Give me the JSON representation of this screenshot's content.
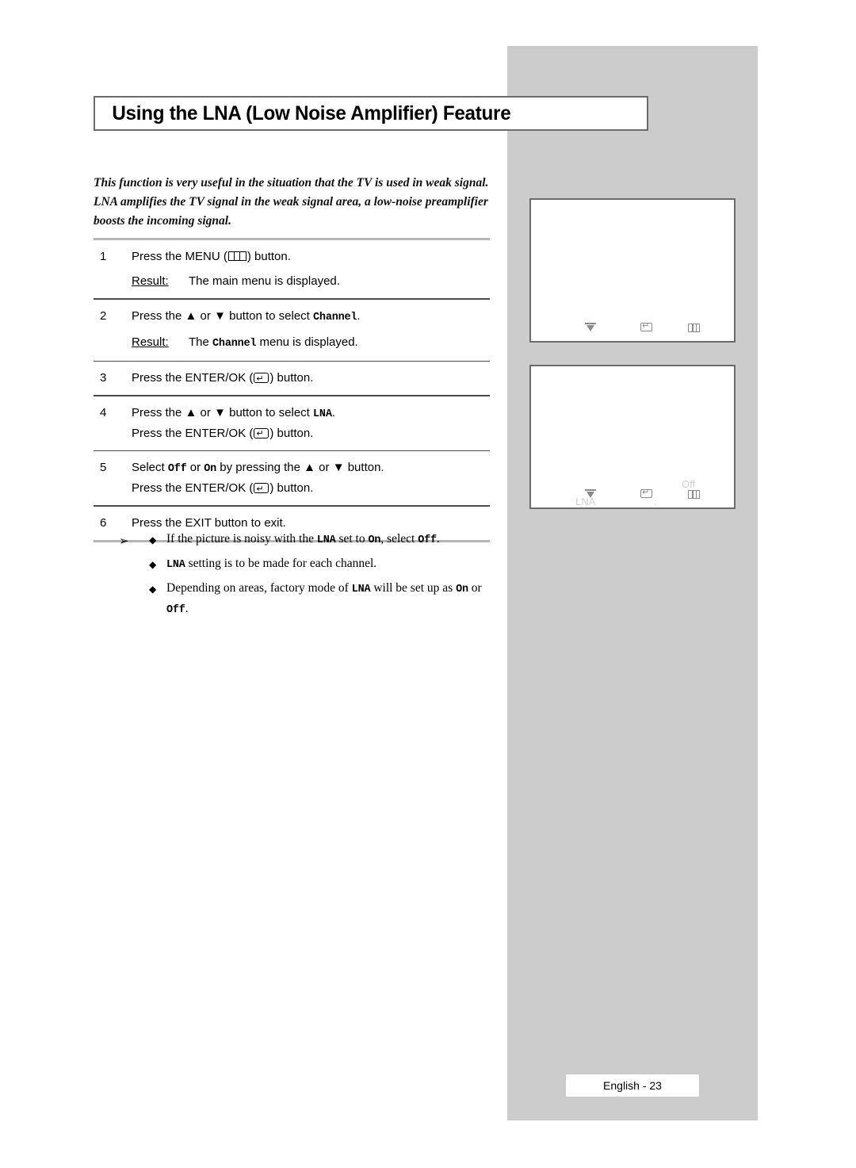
{
  "page": {
    "title": "Using the LNA (Low Noise Amplifier) Feature",
    "intro": "This function is very useful in the situation that the TV is used in weak signal. LNA amplifies the TV signal in the weak signal area, a low-noise preamplifier boosts the incoming signal.",
    "footer": "English - 23"
  },
  "steps": [
    {
      "num": "1",
      "pre": "Press the MENU (",
      "icon": "menu-icon",
      "post": ") button.",
      "result_label": "Result:",
      "result_pre": "The main menu is displayed.",
      "result_mono": "",
      "result_post": ""
    },
    {
      "num": "2",
      "pre": "Press the ",
      "up": "▲",
      "mid": " or ",
      "down": "▼",
      "post": " button to select ",
      "mono": "Channel",
      "tail": ".",
      "result_label": "Result:",
      "result_pre": "The ",
      "result_mono": "Channel",
      "result_post": " menu is displayed."
    },
    {
      "num": "3",
      "pre": "Press the ENTER/OK (",
      "icon": "enter-ok-icon",
      "post": ") button."
    },
    {
      "num": "4",
      "pre": "Press the ",
      "up": "▲",
      "mid": " or ",
      "down": "▼",
      "post": " button to select ",
      "mono": "LNA",
      "tail": ".",
      "line2_pre": "Press the ENTER/OK (",
      "line2_icon": "enter-ok-icon",
      "line2_post": ") button."
    },
    {
      "num": "5",
      "pre": "Select ",
      "mono1": "Off",
      "mid1": " or ",
      "mono2": "On",
      "mid2": " by pressing the ",
      "up": "▲",
      "mid3": " or ",
      "down": "▼",
      "tail": " button.",
      "line2_pre": "Press the ENTER/OK (",
      "line2_icon": "enter-ok-icon",
      "line2_post": ") button."
    },
    {
      "num": "6",
      "pre": "Press the EXIT button to exit."
    }
  ],
  "notes": {
    "arrow": "➢",
    "bullet": "◆",
    "items": [
      {
        "a": "If the picture is noisy with the ",
        "m1": "LNA",
        "b": " set to ",
        "m2": "On",
        "c": ", select ",
        "m3": "Off",
        "d": "."
      },
      {
        "m1": "LNA",
        "b": " setting is to be made for each channel.",
        "a": "",
        "c": "",
        "m2": "",
        "m3": "",
        "d": ""
      },
      {
        "a": "Depending on areas, factory mode of ",
        "m1": "LNA",
        "b": " will be set up as ",
        "m2": "On",
        "c": " or ",
        "m3": "Off",
        "d": "."
      }
    ]
  },
  "screens": [
    {
      "name": "main-menu-screen",
      "osd_label": "",
      "osd_colon": "",
      "osd_value": "",
      "icons": [
        "down-arrow-icon",
        "enter-return-icon",
        "menu-icon"
      ]
    },
    {
      "name": "lna-menu-screen",
      "osd_label": "LNA",
      "osd_colon": ":",
      "osd_value": "Off",
      "icons": [
        "down-arrow-icon",
        "enter-return-icon",
        "menu-icon"
      ]
    }
  ],
  "colors": {
    "panel_gray": "#cccccc",
    "border_gray": "#6b6b6b",
    "osd_text": "#cfcfcf"
  }
}
